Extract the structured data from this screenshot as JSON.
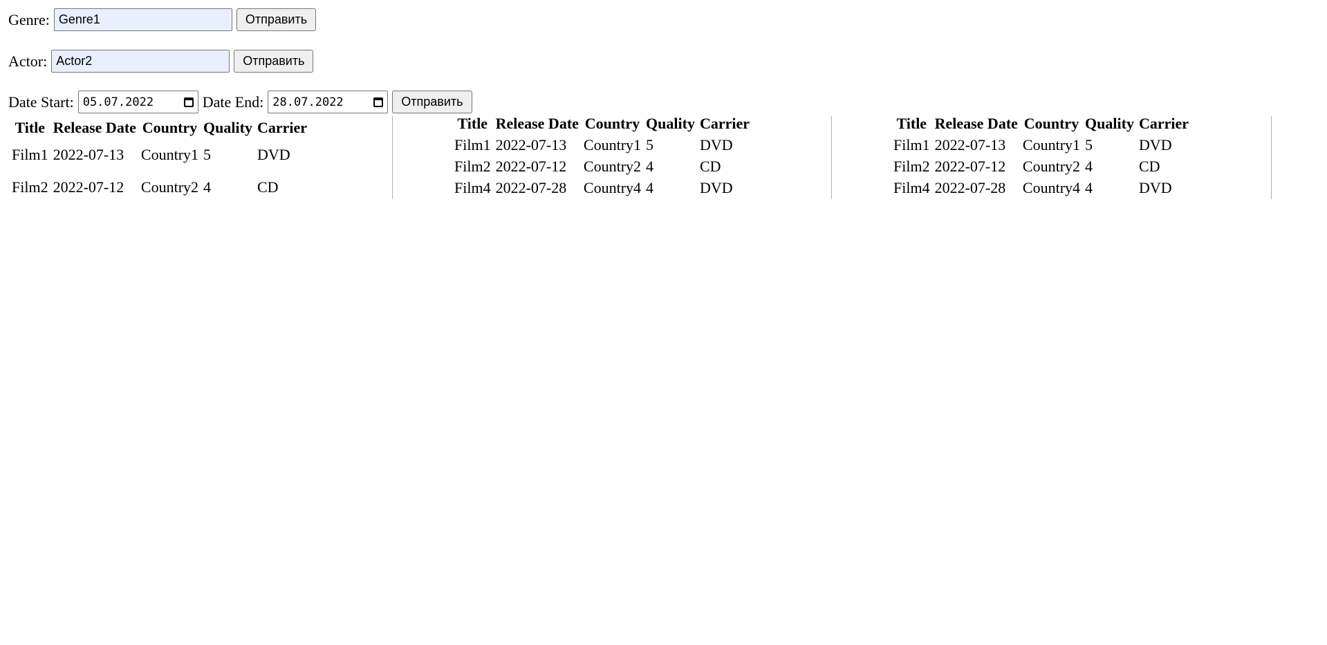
{
  "form": {
    "genre": {
      "label": "Genre:",
      "value": "Genre1",
      "submit": "Отправить"
    },
    "actor": {
      "label": "Actor:",
      "value": "Actor2",
      "submit": "Отправить"
    },
    "dates": {
      "start_label": "Date Start:",
      "start_value": "05.07.2022",
      "end_label": "Date End:",
      "end_value": "28.07.2022",
      "submit": "Отправить"
    }
  },
  "columns": [
    "Title",
    "Release Date",
    "Country",
    "Quality",
    "Carrier"
  ],
  "tables": [
    {
      "rows": [
        [
          "Film1",
          "2022-07-13",
          "Country1",
          "5",
          "DVD"
        ],
        [
          "Film2",
          "2022-07-12",
          "Country2",
          "4",
          "CD"
        ]
      ]
    },
    {
      "rows": [
        [
          "Film1",
          "2022-07-13",
          "Country1",
          "5",
          "DVD"
        ],
        [
          "Film2",
          "2022-07-12",
          "Country2",
          "4",
          "CD"
        ],
        [
          "Film4",
          "2022-07-28",
          "Country4",
          "4",
          "DVD"
        ]
      ]
    },
    {
      "rows": [
        [
          "Film1",
          "2022-07-13",
          "Country1",
          "5",
          "DVD"
        ],
        [
          "Film2",
          "2022-07-12",
          "Country2",
          "4",
          "CD"
        ],
        [
          "Film4",
          "2022-07-28",
          "Country4",
          "4",
          "DVD"
        ]
      ]
    }
  ]
}
